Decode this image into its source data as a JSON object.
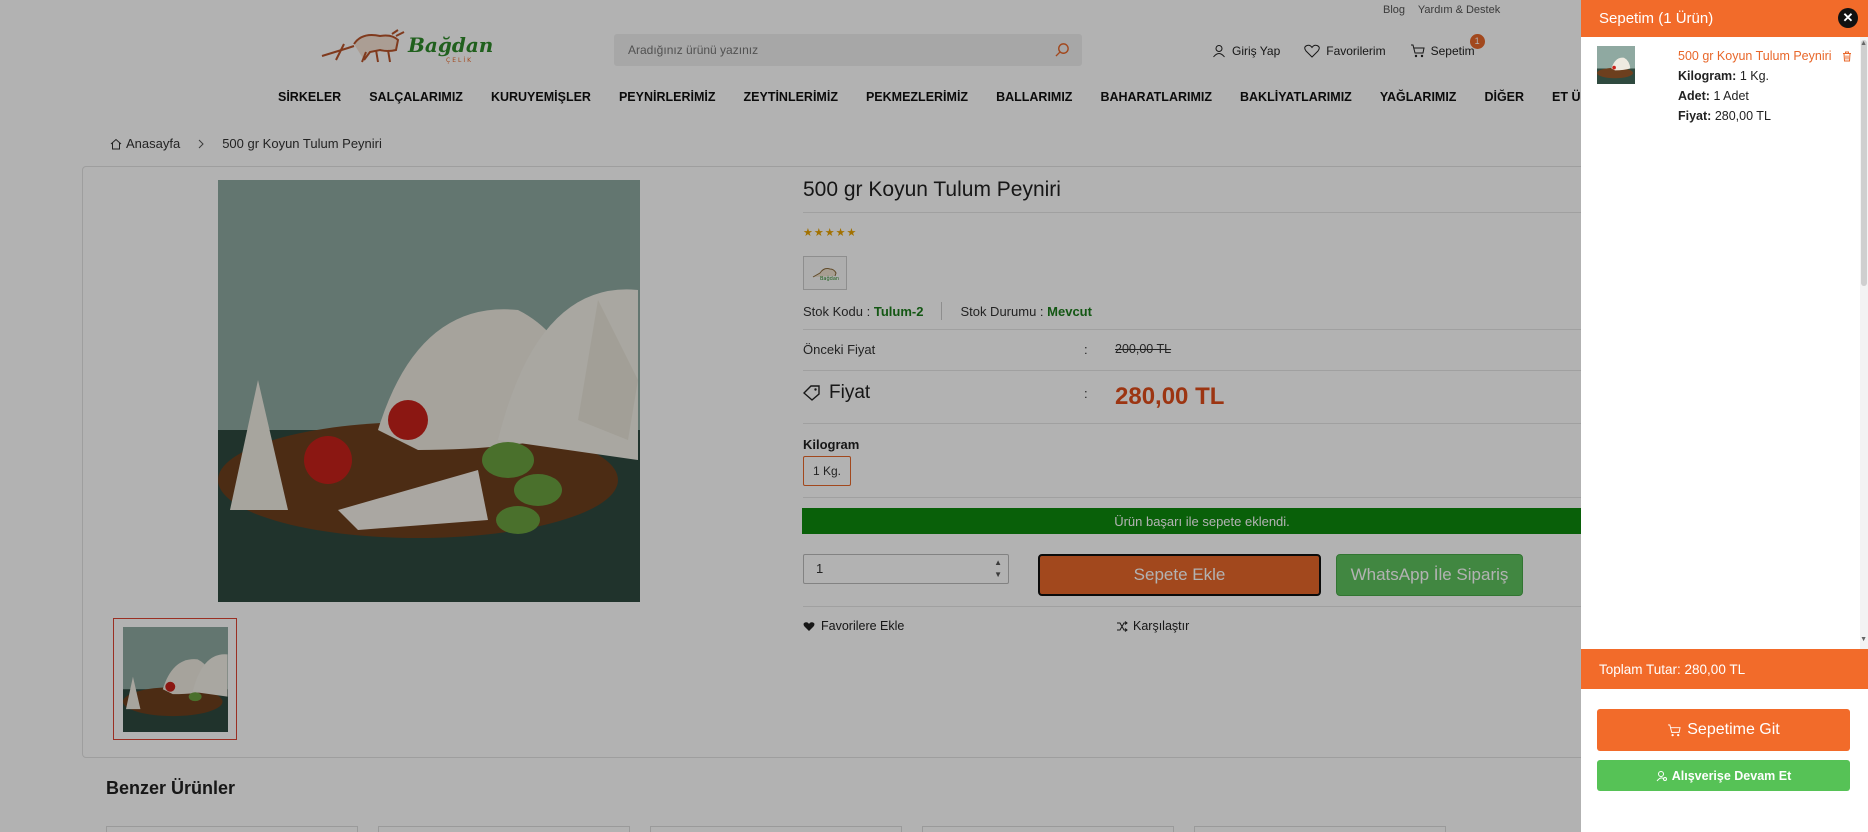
{
  "topbar": {
    "links": [
      "Blog",
      "Yardım & Destek"
    ]
  },
  "logo": {
    "text": "Bağdan",
    "subtext": "ÇELİK"
  },
  "search": {
    "placeholder": "Aradığınız ürünü yazınız"
  },
  "header_actions": {
    "login": "Giriş Yap",
    "favorites": "Favorilerim",
    "cart": "Sepetim",
    "cart_count": "1"
  },
  "nav": [
    "SİRKELER",
    "SALÇALARIMIZ",
    "KURUYEMİŞLER",
    "PEYNİRLERİMİZ",
    "ZEYTİNLERİMİZ",
    "PEKMEZLERİMİZ",
    "BALLARIMIZ",
    "BAHARATLARIMIZ",
    "BAKLİYATLARIMIZ",
    "YAĞLARIMIZ",
    "DİĞER",
    "ET ÜRÜNLERİMİZ"
  ],
  "breadcrumb": {
    "home": "Anasayfa",
    "current": "500 gr Koyun Tulum Peyniri"
  },
  "product": {
    "title": "500 gr Koyun Tulum Peyniri",
    "stars": "★★★★★",
    "stock_code_label": "Stok Kodu :",
    "stock_code": "Tulum-2",
    "stock_status_label": "Stok Durumu :",
    "stock_status": "Mevcut",
    "old_price_label": "Önceki Fiyat",
    "colon": ":",
    "old_price": "200,00 TL",
    "price_label": "Fiyat",
    "price": "280,00 TL",
    "option_title": "Kilogram",
    "option_value": "1 Kg.",
    "success_msg": "Ürün başarı ile sepete eklendi.",
    "quantity": "1",
    "add_to_cart": "Sepete Ekle",
    "whatsapp": "WhatsApp İle Sipariş",
    "add_fav": "Favorilere Ekle",
    "compare": "Karşılaştır"
  },
  "similar": {
    "title": "Benzer Ürünler"
  },
  "cart_drawer": {
    "title": "Sepetim (1 Ürün)",
    "close": "✕",
    "item": {
      "name": "500 gr Koyun Tulum Peyniri",
      "kg_label": "Kilogram:",
      "kg_value": "1 Kg.",
      "qty_label": "Adet:",
      "qty_value": "1 Adet",
      "price_label": "Fiyat:",
      "price_value": "280,00 TL"
    },
    "total": "Toplam Tutar: 280,00 TL",
    "go_to_cart": "Sepetime Git",
    "continue": "Alışverişe Devam Et"
  },
  "colors": {
    "accent": "#f26b2a",
    "price": "#e04d1a",
    "success": "#0d8a0d",
    "whatsapp": "#5ec25e",
    "stock_green": "#1d7d1d"
  },
  "icons": [
    "search-icon",
    "user-icon",
    "heart-icon",
    "cart-icon",
    "home-icon",
    "chevron-right-icon",
    "tag-icon",
    "shuffle-icon",
    "trash-icon",
    "close-icon"
  ]
}
